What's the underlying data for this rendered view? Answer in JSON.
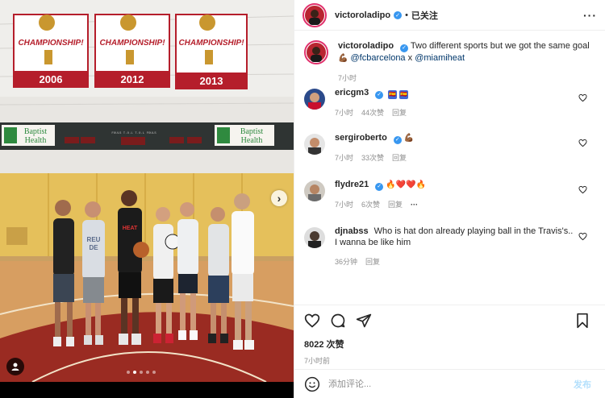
{
  "post": {
    "username": "victoroladipo",
    "follow_sep": "•",
    "follow_state": "已关注",
    "more": "···",
    "caption_text": "Two different sports but we got the same goal",
    "caption_emoji": "💪🏾",
    "caption_mention1": "@fcbarcelona",
    "caption_x": " x ",
    "caption_mention2": "@miamiheat",
    "caption_time": "7小时"
  },
  "photo": {
    "banners": [
      {
        "title": "CHAMPIONSHIP!",
        "year": "2006"
      },
      {
        "title": "CHAMPIONSHIP!",
        "year": "2012"
      },
      {
        "title": "CHAMPIONSHIP!",
        "year": "2013"
      }
    ],
    "sign_left": {
      "line1": "Baptist",
      "line2": "Health"
    },
    "sign_right": {
      "line1": "Baptist",
      "line2": "Health"
    },
    "scoreboard": "FOULS  T.O.L                T.O.L  FOULS",
    "shirt_text": "REU\nDE",
    "jersey_text": "HEAT",
    "dots": 5,
    "active_dot": 1
  },
  "comments": [
    {
      "user": "ericgm3",
      "verified": true,
      "text": "",
      "flags": [
        "🇪🇸",
        "🇪🇸"
      ],
      "time": "7小时",
      "likes": "44次赞",
      "reply": "回复",
      "extra": ""
    },
    {
      "user": "sergiroberto",
      "verified": true,
      "text": "💪🏾",
      "flags": [],
      "time": "7小时",
      "likes": "33次赞",
      "reply": "回复",
      "extra": ""
    },
    {
      "user": "flydre21",
      "verified": true,
      "text": "🔥❤️❤️🔥",
      "flags": [],
      "time": "7小时",
      "likes": "6次赞",
      "reply": "回复",
      "extra": "···"
    },
    {
      "user": "djnabss",
      "verified": false,
      "text": "Who is hat don already playing ball in the Travis's.. I wanna be like him",
      "flags": [],
      "time": "36分钟",
      "likes": "",
      "reply": "回复",
      "extra": ""
    }
  ],
  "actions": {
    "likes_count": "8022 次赞",
    "time_ago": "7小时前"
  },
  "composer": {
    "placeholder": "添加评论...",
    "post_label": "发布"
  },
  "colors": {
    "accent": "#3897f0",
    "link": "#00376b",
    "court": "#d79e61",
    "wall_yellow": "#e5c05b"
  }
}
